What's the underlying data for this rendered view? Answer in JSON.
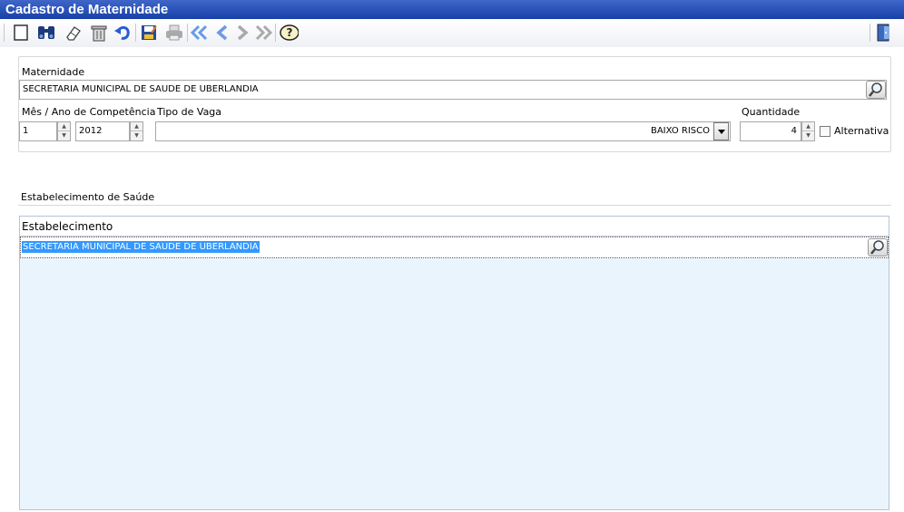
{
  "window": {
    "title": "Cadastro de Maternidade"
  },
  "toolbar": {
    "buttons": [
      {
        "name": "new-icon"
      },
      {
        "name": "search-binoculars-icon"
      },
      {
        "name": "clear-eraser-icon"
      },
      {
        "name": "delete-trash-icon"
      },
      {
        "name": "undo-icon"
      },
      {
        "name": "save-icon"
      },
      {
        "name": "print-icon"
      },
      {
        "name": "first-record-icon"
      },
      {
        "name": "previous-record-icon"
      },
      {
        "name": "next-record-icon"
      },
      {
        "name": "last-record-icon"
      },
      {
        "name": "help-icon"
      },
      {
        "name": "exit-door-icon"
      }
    ]
  },
  "form": {
    "maternidade_label": "Maternidade",
    "maternidade_value": "SECRETARIA MUNICIPAL DE SAUDE DE UBERLANDIA",
    "competencia_label": "Mês / Ano de Competência",
    "mes_value": "1",
    "ano_value": "2012",
    "tipo_vaga_label": "Tipo de Vaga",
    "tipo_vaga_value": "BAIXO RISCO",
    "quantidade_label": "Quantidade",
    "quantidade_value": "4",
    "alternativa_label": "Alternativa",
    "alternativa_checked": false
  },
  "estabelecimento": {
    "section_label": "Estabelecimento de Saúde",
    "column_header": "Estabelecimento",
    "rows": [
      {
        "value": "SECRETARIA MUNICIPAL DE SAUDE DE UBERLANDIA",
        "selected": true
      }
    ]
  },
  "colors": {
    "title_bar": "#1f48b0",
    "grid_background": "#eaf4fc",
    "selection": "#3399ff"
  }
}
